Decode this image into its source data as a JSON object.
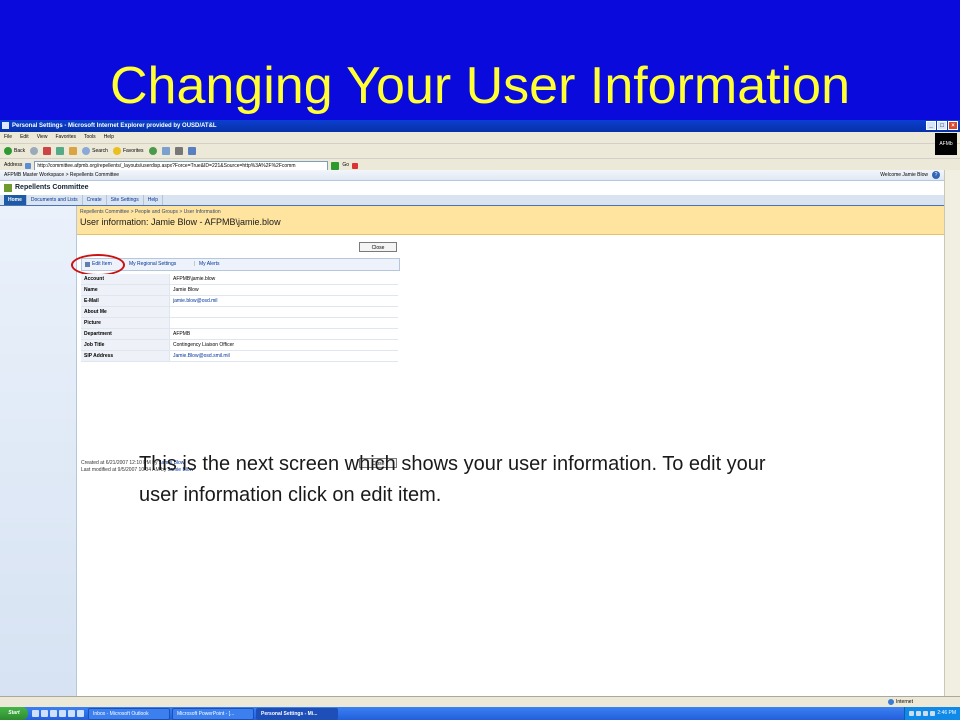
{
  "slide": {
    "title": "Changing Your User Information",
    "caption_line1": "This is the next screen which shows your user information.  To edit your",
    "caption_line2": "user information click on edit item."
  },
  "browser": {
    "window_title": "Personal Settings - Microsoft Internet Explorer provided by OUSD/AT&L",
    "menu": [
      "File",
      "Edit",
      "View",
      "Favorites",
      "Tools",
      "Help"
    ],
    "toolbar": {
      "back": "Back",
      "search": "Search",
      "favorites": "Favorites"
    },
    "address_label": "Address",
    "address_url": "http://committee.afpmb.org/repellents/_layouts/userdisp.aspx?Force=True&ID=221&Source=http%3A%2F%2Fcomm",
    "go_label": "Go",
    "logo_text": "AFMb",
    "status_text": "Internet"
  },
  "sharepoint": {
    "top_breadcrumb": "AFPMB Master Workspace > Repellents Committee",
    "welcome": "Welcome Jamie Blow",
    "site_title": "Repellents Committee",
    "tabs": [
      "Home",
      "Documents and Lists",
      "Create",
      "Site Settings",
      "Help"
    ],
    "breadcrumb": "Repellents Committee > People and Groups > User Information",
    "page_title": "User information: Jamie Blow - AFPMB\\jamie.blow",
    "close_label": "Close",
    "actions": {
      "edit_item": "Edit Item",
      "regional": "My Regional Settings",
      "sep": "|",
      "alerts": "My Alerts"
    },
    "fields": [
      {
        "label": "Account",
        "value": "AFPMB\\jamie.blow"
      },
      {
        "label": "Name",
        "value": "Jamie Blow"
      },
      {
        "label": "E-Mail",
        "value": "jamie.blow@osd.mil"
      },
      {
        "label": "About Me",
        "value": ""
      },
      {
        "label": "Picture",
        "value": ""
      },
      {
        "label": "Department",
        "value": "AFPMB"
      },
      {
        "label": "Job Title",
        "value": "Contingency Liaison Officer"
      },
      {
        "label": "SIP Address",
        "value": "Jamie.Blow@osd.smil.mil"
      }
    ],
    "created_text": "Created at 6/21/2007 12:10 PM  by",
    "modified_text": "Last modified at 9/5/2007 10:34 AM  by",
    "author": "Jamie Blow"
  },
  "taskbar": {
    "start": "Start",
    "tasks": [
      "Inbox - Microsoft Outlook",
      "Microsoft PowerPoint - [...",
      "Personal Settings - Mi..."
    ],
    "clock": "2:46 PM"
  },
  "colors": {
    "slide_bg": "#0a0adc",
    "title_yellow": "#ffff33",
    "highlight_ring": "#cc1111"
  }
}
